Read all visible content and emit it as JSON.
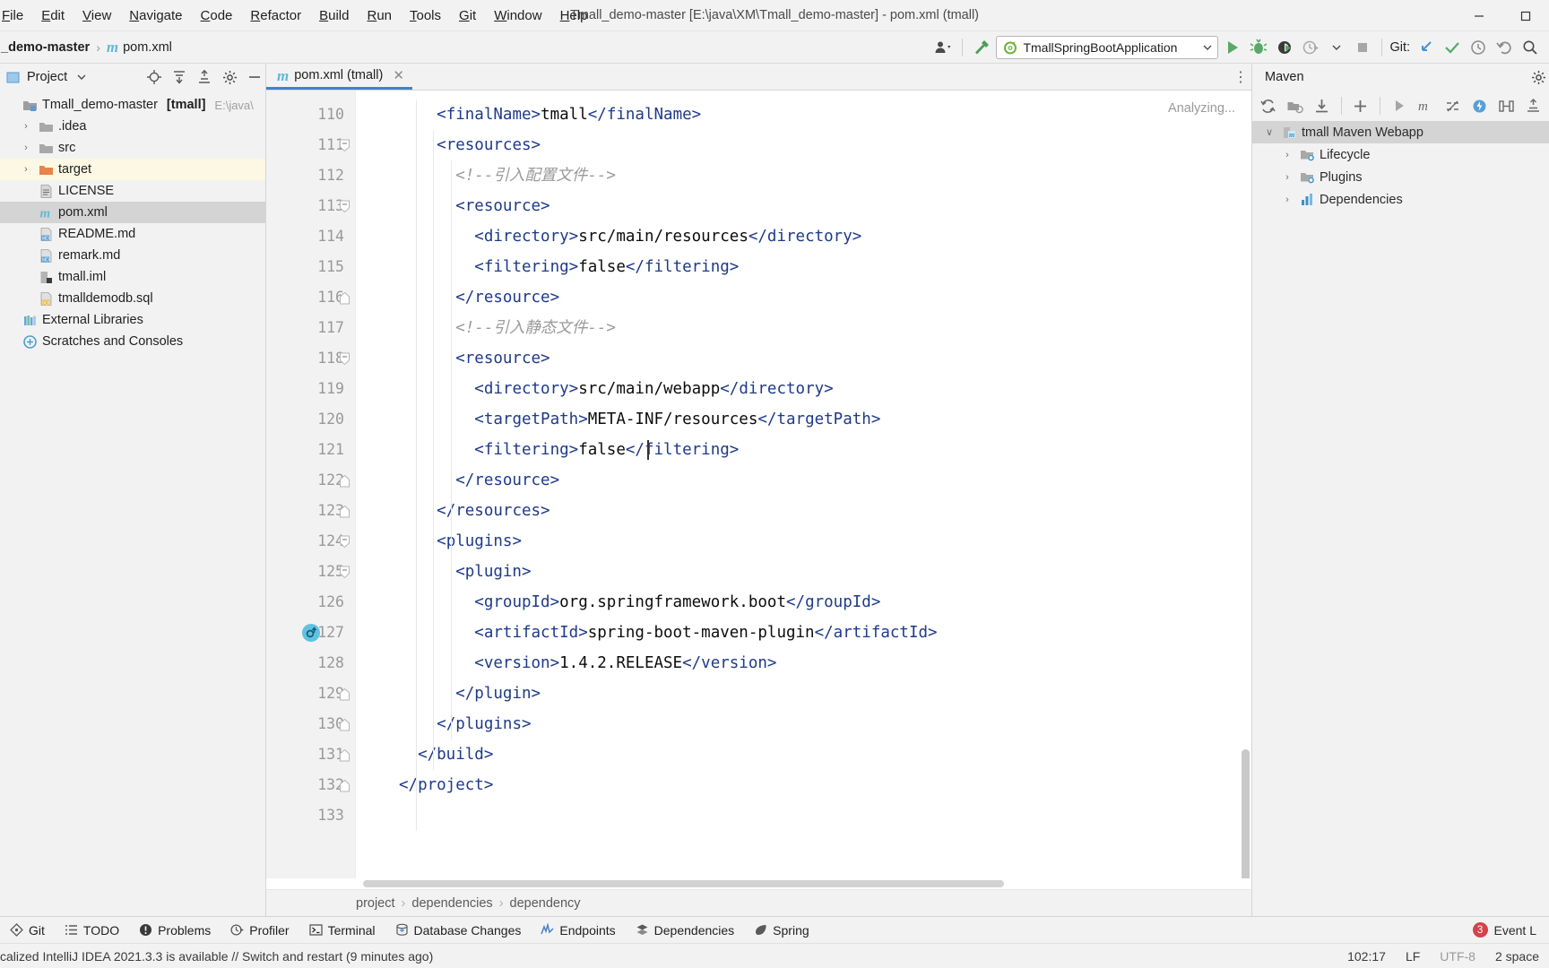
{
  "window": {
    "title": "Tmall_demo-master [E:\\java\\XM\\Tmall_demo-master] - pom.xml (tmall)",
    "minimize_icon": "minimize-icon",
    "maximize_icon": "maximize-icon"
  },
  "menu": [
    {
      "label": "File"
    },
    {
      "label": "Edit"
    },
    {
      "label": "View"
    },
    {
      "label": "Navigate"
    },
    {
      "label": "Code"
    },
    {
      "label": "Refactor"
    },
    {
      "label": "Build"
    },
    {
      "label": "Run"
    },
    {
      "label": "Tools"
    },
    {
      "label": "Git"
    },
    {
      "label": "Window"
    },
    {
      "label": "Help"
    }
  ],
  "navbar": {
    "project_crumb": "ll_demo-master",
    "file_crumb": "pom.xml",
    "separator": "›",
    "run_config": "TmallSpringBootApplication",
    "git_label": "Git:",
    "icons": [
      "user-settings-icon",
      "build-hammer-icon",
      "run-icon",
      "debug-icon",
      "run-with-coverage-icon",
      "profile-icon",
      "dropdown-icon",
      "stop-icon",
      "git-update-icon",
      "git-commit-icon",
      "git-history-icon",
      "git-rollback-icon",
      "search-icon"
    ]
  },
  "project_pane": {
    "title": "Project",
    "header_icons": [
      "locate-icon",
      "expand-all-icon",
      "collapse-all-icon",
      "settings-gear-icon",
      "hide-icon"
    ],
    "tree": [
      {
        "label": "Tmall_demo-master",
        "bold": "[tmall]",
        "sub": "E:\\java\\",
        "icon": "project-module-icon",
        "arrow": "",
        "indent": 0,
        "state": "root"
      },
      {
        "label": ".idea",
        "icon": "folder-icon",
        "arrow": "›",
        "indent": 1,
        "state": ""
      },
      {
        "label": "src",
        "icon": "folder-icon",
        "arrow": "›",
        "indent": 1,
        "state": ""
      },
      {
        "label": "target",
        "icon": "folder-orange-icon",
        "arrow": "›",
        "indent": 1,
        "state": "highlighted"
      },
      {
        "label": "LICENSE",
        "icon": "text-file-icon",
        "arrow": "",
        "indent": 1,
        "state": ""
      },
      {
        "label": "pom.xml",
        "icon": "maven-file-icon",
        "arrow": "",
        "indent": 1,
        "state": "selected"
      },
      {
        "label": "README.md",
        "icon": "markdown-file-icon",
        "arrow": "",
        "indent": 1,
        "state": ""
      },
      {
        "label": "remark.md",
        "icon": "markdown-file-icon",
        "arrow": "",
        "indent": 1,
        "state": ""
      },
      {
        "label": "tmall.iml",
        "icon": "iml-file-icon",
        "arrow": "",
        "indent": 1,
        "state": ""
      },
      {
        "label": "tmalldemodb.sql",
        "icon": "sql-file-icon",
        "arrow": "",
        "indent": 1,
        "state": ""
      },
      {
        "label": "External Libraries",
        "icon": "libraries-icon",
        "arrow": "",
        "indent": 0,
        "state": ""
      },
      {
        "label": "Scratches and Consoles",
        "icon": "scratches-icon",
        "arrow": "",
        "indent": 0,
        "state": ""
      }
    ]
  },
  "editor": {
    "tab_label": "pom.xml (tmall)",
    "tab_icon": "maven-file-icon",
    "tab_close_icon": "close-icon",
    "kebab_icon": "more-options-icon",
    "analyzing_status": "Analyzing...",
    "first_line": 110,
    "lines": [
      {
        "n": 110,
        "fold": "",
        "indent": 4,
        "parts": [
          {
            "t": "tag",
            "s": "<finalName>"
          },
          {
            "t": "txt",
            "s": "tmall"
          },
          {
            "t": "tag",
            "s": "</finalName>"
          }
        ]
      },
      {
        "n": 111,
        "fold": "minus",
        "indent": 4,
        "parts": [
          {
            "t": "tag",
            "s": "<resources>"
          }
        ]
      },
      {
        "n": 112,
        "fold": "",
        "indent": 6,
        "parts": [
          {
            "t": "cmt",
            "s": "<!--引入配置文件-->"
          }
        ]
      },
      {
        "n": 113,
        "fold": "minus",
        "indent": 6,
        "parts": [
          {
            "t": "tag",
            "s": "<resource>"
          }
        ]
      },
      {
        "n": 114,
        "fold": "",
        "indent": 8,
        "parts": [
          {
            "t": "tag",
            "s": "<directory>"
          },
          {
            "t": "txt",
            "s": "src/main/resources"
          },
          {
            "t": "tag",
            "s": "</directory>"
          }
        ]
      },
      {
        "n": 115,
        "fold": "",
        "indent": 8,
        "parts": [
          {
            "t": "tag",
            "s": "<filtering>"
          },
          {
            "t": "txt",
            "s": "false"
          },
          {
            "t": "tag",
            "s": "</filtering>"
          }
        ]
      },
      {
        "n": 116,
        "fold": "end",
        "indent": 6,
        "parts": [
          {
            "t": "tag",
            "s": "</resource>"
          }
        ]
      },
      {
        "n": 117,
        "fold": "",
        "indent": 6,
        "parts": [
          {
            "t": "cmt",
            "s": "<!--引入静态文件-->"
          }
        ]
      },
      {
        "n": 118,
        "fold": "minus",
        "indent": 6,
        "parts": [
          {
            "t": "tag",
            "s": "<resource>"
          }
        ]
      },
      {
        "n": 119,
        "fold": "",
        "indent": 8,
        "parts": [
          {
            "t": "tag",
            "s": "<directory>"
          },
          {
            "t": "txt",
            "s": "src/main/webapp"
          },
          {
            "t": "tag",
            "s": "</directory>"
          }
        ]
      },
      {
        "n": 120,
        "fold": "",
        "indent": 8,
        "parts": [
          {
            "t": "tag",
            "s": "<targetPath>"
          },
          {
            "t": "txt",
            "s": "META-INF/resources"
          },
          {
            "t": "tag",
            "s": "</targetPath>"
          }
        ]
      },
      {
        "n": 121,
        "fold": "",
        "indent": 8,
        "parts": [
          {
            "t": "tag",
            "s": "<filtering>"
          },
          {
            "t": "txt",
            "s": "false"
          },
          {
            "t": "tag",
            "s": "</filtering>"
          }
        ]
      },
      {
        "n": 122,
        "fold": "end",
        "indent": 6,
        "parts": [
          {
            "t": "tag",
            "s": "</resource>"
          }
        ]
      },
      {
        "n": 123,
        "fold": "end",
        "indent": 4,
        "parts": [
          {
            "t": "tag",
            "s": "</resources>"
          }
        ]
      },
      {
        "n": 124,
        "fold": "minus",
        "indent": 4,
        "parts": [
          {
            "t": "tag",
            "s": "<plugins>"
          }
        ]
      },
      {
        "n": 125,
        "fold": "minus",
        "indent": 6,
        "parts": [
          {
            "t": "tag",
            "s": "<plugin>"
          }
        ]
      },
      {
        "n": 126,
        "fold": "",
        "indent": 8,
        "parts": [
          {
            "t": "tag",
            "s": "<groupId>"
          },
          {
            "t": "txt",
            "s": "org.springframework.boot"
          },
          {
            "t": "tag",
            "s": "</groupId>"
          }
        ]
      },
      {
        "n": 127,
        "fold": "",
        "indent": 8,
        "gutter_icon": "maven-reimport-icon",
        "parts": [
          {
            "t": "tag",
            "s": "<artifactId>"
          },
          {
            "t": "txt",
            "s": "spring-boot-maven-plugin"
          },
          {
            "t": "tag",
            "s": "</artifactId>"
          }
        ]
      },
      {
        "n": 128,
        "fold": "",
        "indent": 8,
        "parts": [
          {
            "t": "tag",
            "s": "<version>"
          },
          {
            "t": "txt",
            "s": "1.4.2.RELEASE"
          },
          {
            "t": "tag",
            "s": "</version>"
          }
        ]
      },
      {
        "n": 129,
        "fold": "end",
        "indent": 6,
        "parts": [
          {
            "t": "tag",
            "s": "</plugin>"
          }
        ]
      },
      {
        "n": 130,
        "fold": "end",
        "indent": 4,
        "parts": [
          {
            "t": "tag",
            "s": "</plugins>"
          }
        ]
      },
      {
        "n": 131,
        "fold": "end",
        "indent": 2,
        "parts": [
          {
            "t": "tag",
            "s": "</build>"
          }
        ]
      },
      {
        "n": 132,
        "fold": "end",
        "indent": 0,
        "parts": [
          {
            "t": "tag",
            "s": "</project>"
          }
        ]
      },
      {
        "n": 133,
        "fold": "",
        "indent": 0,
        "parts": []
      }
    ],
    "breadcrumbs": [
      "project",
      "dependencies",
      "dependency"
    ],
    "breadcrumb_sep": "›"
  },
  "maven_pane": {
    "title": "Maven",
    "settings_icon": "settings-gear-icon",
    "toolbar_icons": [
      "reload-all-icon",
      "generate-sources-icon",
      "download-sources-icon",
      "add-icon",
      "run-maven-build-icon",
      "toggle-offline-icon",
      "skip-tests-icon",
      "execute-goal-icon",
      "show-dependencies-icon",
      "collapse-all-icon"
    ],
    "tree": [
      {
        "label": "tmall Maven Webapp",
        "icon": "maven-project-icon",
        "arrow": "∨",
        "indent": 0,
        "state": "selected"
      },
      {
        "label": "Lifecycle",
        "icon": "maven-folder-icon",
        "arrow": "›",
        "indent": 1,
        "state": ""
      },
      {
        "label": "Plugins",
        "icon": "maven-folder-icon",
        "arrow": "›",
        "indent": 1,
        "state": ""
      },
      {
        "label": "Dependencies",
        "icon": "maven-deps-icon",
        "arrow": "›",
        "indent": 1,
        "state": ""
      }
    ]
  },
  "tool_window_bar": {
    "items": [
      {
        "label": "Git",
        "icon": "git-icon"
      },
      {
        "label": "TODO",
        "icon": "todo-icon"
      },
      {
        "label": "Problems",
        "icon": "problems-icon"
      },
      {
        "label": "Profiler",
        "icon": "profiler-icon"
      },
      {
        "label": "Terminal",
        "icon": "terminal-icon"
      },
      {
        "label": "Database Changes",
        "icon": "database-changes-icon"
      },
      {
        "label": "Endpoints",
        "icon": "endpoints-icon"
      },
      {
        "label": "Dependencies",
        "icon": "dependencies-icon"
      },
      {
        "label": "Spring",
        "icon": "spring-leaf-icon"
      }
    ],
    "event_log_label": "Event L",
    "event_log_badge": "3"
  },
  "status_bar": {
    "message": "calized IntelliJ IDEA 2021.3.3 is available // Switch and restart (9 minutes ago)",
    "caret_position": "102:17",
    "line_separator": "LF",
    "encoding": "UTF-8",
    "indent": "2 space"
  },
  "colors": {
    "accent_blue": "#4083c9",
    "tag_blue": "#1e3a8a",
    "comment_gray": "#9a9a9a",
    "selection_gray": "#d4d4d4",
    "highlight_yellow": "#fcf8e3",
    "badge_red": "#d4434a",
    "green_run": "#59a869",
    "maven_icon_blue": "#60b8d8"
  }
}
